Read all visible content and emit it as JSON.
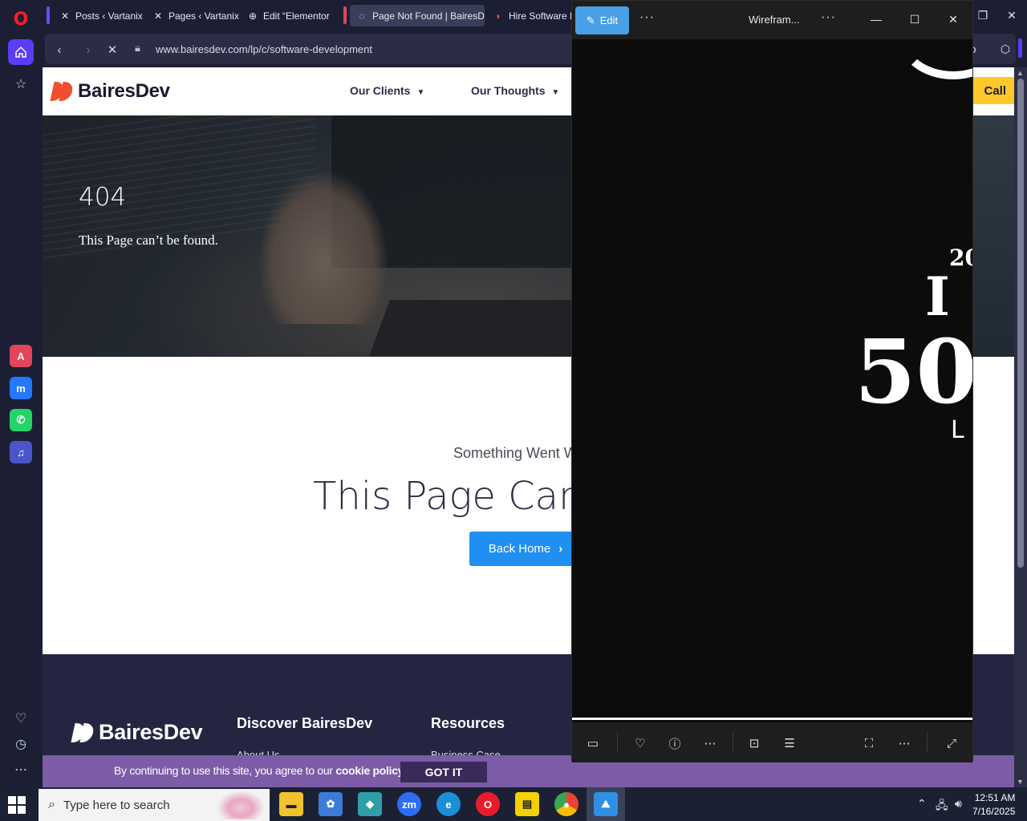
{
  "browser": {
    "tabs": [
      {
        "label": "Posts ‹ Vartanix",
        "icon": "x-logo-icon"
      },
      {
        "label": "Pages ‹ Vartanix",
        "icon": "x-logo-icon"
      },
      {
        "label": "Edit “Elementor",
        "icon": "wordpress-icon"
      },
      {
        "label": "Page Not Found | BairesDev",
        "icon": "loading-icon"
      },
      {
        "label": "Hire Software D",
        "icon": "bairesdev-icon"
      }
    ],
    "url": "www.bairesdev.com/lp/c/software-development"
  },
  "site": {
    "brand": "BairesDev",
    "nav": [
      {
        "label": "Our Clients"
      },
      {
        "label": "Our Thoughts"
      }
    ],
    "cta_label": "Call",
    "hero": {
      "code": "404",
      "subtitle": "This Page can’t be found."
    },
    "error": {
      "small": "Something Went W",
      "big": "This Page Can’t",
      "button": "Back Home"
    },
    "footer": {
      "brand": "BairesDev",
      "col1_title": "Discover BairesDev",
      "col1_link": "About Us",
      "col2_title": "Resources",
      "col2_link": "Business Case"
    },
    "cookie": {
      "text": "By continuing to use this site, you agree to our ",
      "link": "cookie policy.",
      "button": "GOT IT"
    }
  },
  "viewer": {
    "edit_label": "Edit",
    "title": "Wirefram...",
    "image_text": {
      "year": "20",
      "big1": "I",
      "big2": "50",
      "small": "L I"
    }
  },
  "taskbar": {
    "search_placeholder": "Type here to search",
    "time": "12:51 AM",
    "date": "7/16/2025",
    "apps": [
      "file-explorer-icon",
      "paint-icon",
      "app-icon",
      "zoom-icon",
      "edge-icon",
      "opera-icon",
      "sticky-notes-icon",
      "chrome-icon",
      "photos-icon"
    ]
  },
  "colors": {
    "opera_accent": "#5a3df5",
    "brand_orange": "#f04e2e",
    "cta_yellow": "#ffc72c",
    "button_blue": "#1f8ff2",
    "footer_bg": "#252541",
    "cookie_bg": "#7c5ca6",
    "edit_blue": "#4aa0e6"
  }
}
